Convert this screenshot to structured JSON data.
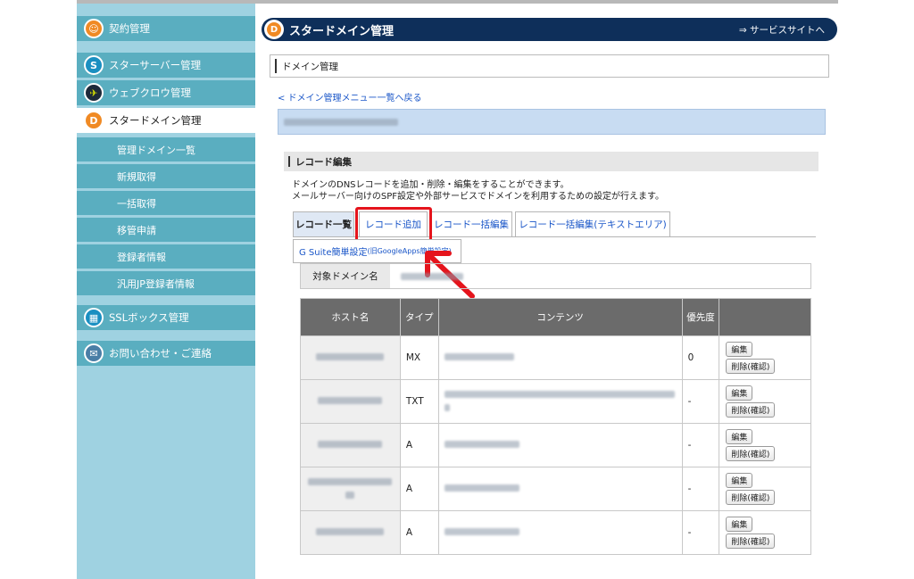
{
  "sidebar": {
    "items": [
      {
        "label": "契約管理",
        "icon": "contract-icon"
      },
      {
        "label": "スターサーバー管理",
        "icon": "star-server-icon"
      },
      {
        "label": "ウェブクロウ管理",
        "icon": "webcrow-icon"
      },
      {
        "label": "スタードメイン管理",
        "icon": "star-domain-icon"
      },
      {
        "label": "SSLボックス管理",
        "icon": "ssl-box-icon"
      },
      {
        "label": "お問い合わせ・ご連絡",
        "icon": "mail-icon"
      }
    ],
    "subitems": [
      {
        "label": "管理ドメイン一覧"
      },
      {
        "label": "新規取得"
      },
      {
        "label": "一括取得"
      },
      {
        "label": "移管申請"
      },
      {
        "label": "登録者情報"
      },
      {
        "label": "汎用JP登録者情報"
      }
    ]
  },
  "header": {
    "title": "スタードメイン管理",
    "service_link": "⇒ サービスサイトへ"
  },
  "breadcrumb": "ドメイン管理",
  "back_link": "< ドメイン管理メニュー一覧へ戻る",
  "section": {
    "title": "レコード編集",
    "desc_line1": "ドメインのDNSレコードを追加・削除・編集をすることができます。",
    "desc_line2": "メールサーバー向けのSPF設定や外部サービスでドメインを利用するための設定が行えます。"
  },
  "tabs": [
    {
      "label": "レコード一覧"
    },
    {
      "label": "レコード追加"
    },
    {
      "label": "レコード一括編集"
    },
    {
      "label": "レコード一括編集(テキストエリア)"
    }
  ],
  "subtab": {
    "label": "G Suite簡単設定",
    "note": "(旧GoogleApps簡単設定)"
  },
  "target_label": "対象ドメイン名",
  "table": {
    "headers": {
      "host": "ホスト名",
      "type": "タイプ",
      "content": "コンテンツ",
      "priority": "優先度"
    },
    "rows": [
      {
        "type": "MX",
        "priority": "0"
      },
      {
        "type": "TXT",
        "priority": "-"
      },
      {
        "type": "A",
        "priority": "-"
      },
      {
        "type": "A",
        "priority": "-"
      },
      {
        "type": "A",
        "priority": "-"
      }
    ],
    "edit_label": "編集",
    "delete_label": "削除(確認)"
  },
  "colors": {
    "accent": "#0e2f5a",
    "sidebar": "#5aaec0",
    "highlight": "#e5141c"
  }
}
